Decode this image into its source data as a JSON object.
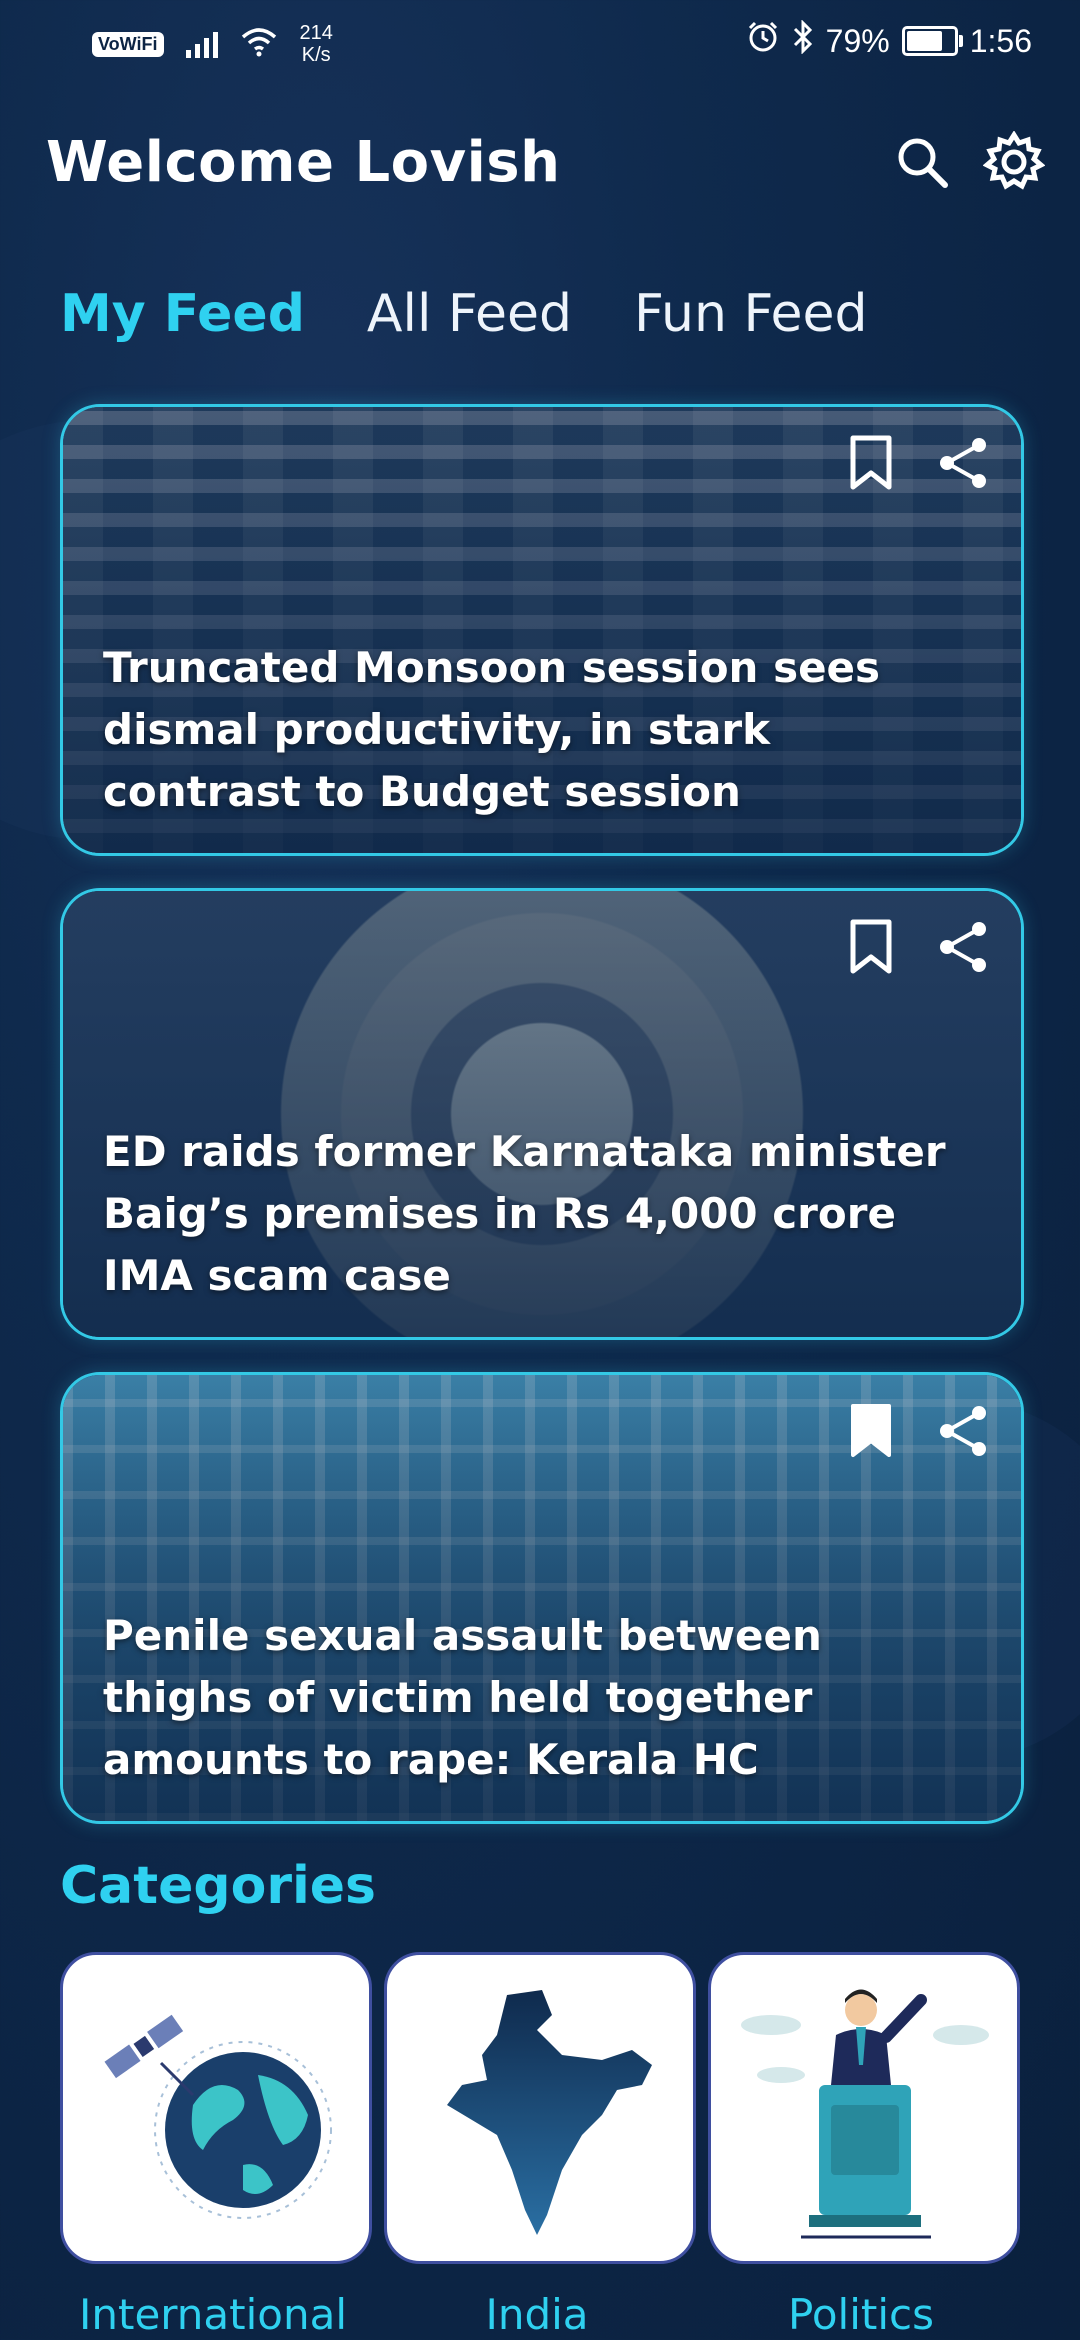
{
  "status_bar": {
    "network_badge": "VoWiFi",
    "speed_value": "214",
    "speed_unit": "K/s",
    "battery": "79%",
    "time": "1:56"
  },
  "header": {
    "title": "Welcome Lovish"
  },
  "tabs": [
    {
      "label": "My Feed",
      "active": true
    },
    {
      "label": "All Feed",
      "active": false
    },
    {
      "label": "Fun Feed",
      "active": false
    }
  ],
  "feed": [
    {
      "title": "Truncated Monsoon session sees dismal productivity, in stark contrast to Budget session",
      "bookmarked": false
    },
    {
      "title": "ED raids former Karnataka minister Baig’s premises in Rs 4,000 crore IMA scam case",
      "bookmarked": false
    },
    {
      "title": "Penile sexual assault between thighs of victim held together amounts to rape: Kerala HC",
      "bookmarked": true
    }
  ],
  "categories": {
    "title": "Categories",
    "items": [
      {
        "label": "International",
        "icon": "globe-satellite-icon"
      },
      {
        "label": "India",
        "icon": "india-map-icon"
      },
      {
        "label": "Politics",
        "icon": "politician-podium-icon"
      }
    ]
  },
  "colors": {
    "accent": "#2fd1f0",
    "background": "#0c2444",
    "card_border": "#33c9e6"
  }
}
